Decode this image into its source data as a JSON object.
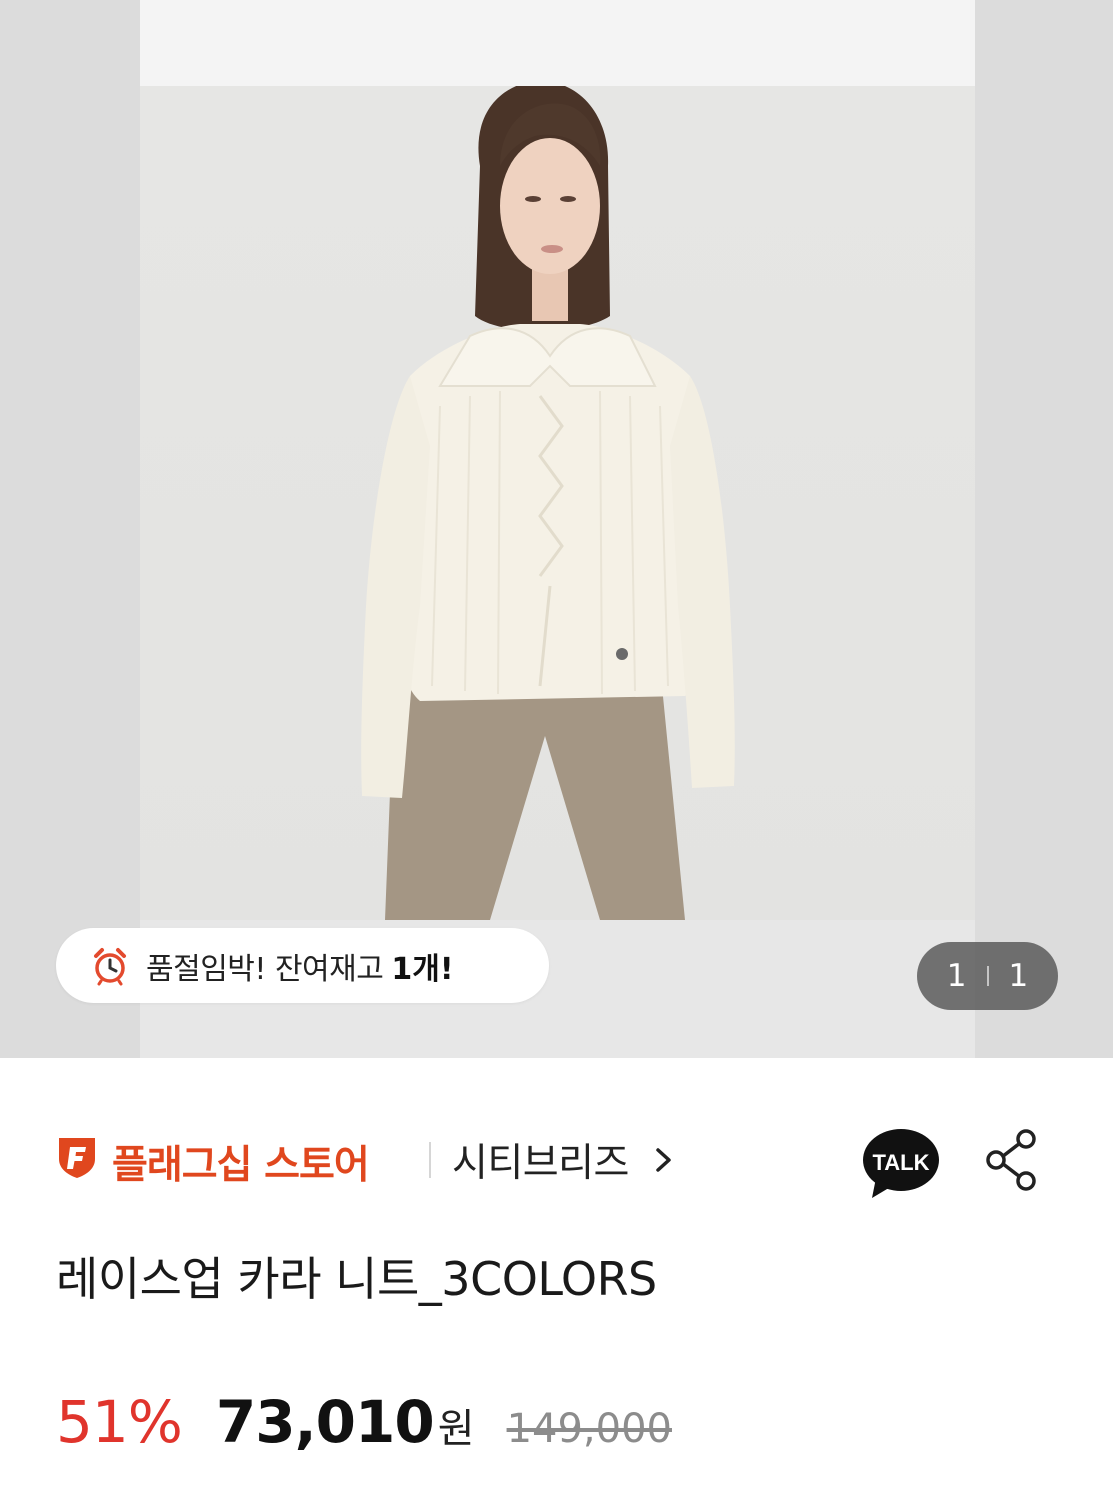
{
  "hero": {
    "image_alt": "",
    "stock_badge": {
      "icon": "alarm-clock-icon",
      "text": "품절임박! 잔여재고",
      "count": "1개!"
    },
    "page_counter": {
      "current": "1",
      "total": "1"
    }
  },
  "store": {
    "flagship_icon": "flagship-f-icon",
    "flagship_label": "플래그십 스토어",
    "brand_name": "시티브리즈",
    "talk_label": "TALK",
    "share_icon": "share-icon"
  },
  "product": {
    "title": "레이스업 카라 니트_3COLORS",
    "discount": "51%",
    "sale_price": "73,010",
    "currency": "원",
    "original_price": "149,000"
  },
  "colors": {
    "accent": "#e0471e",
    "discount": "#e0342c",
    "counter_bg": "#5a5a5a"
  }
}
